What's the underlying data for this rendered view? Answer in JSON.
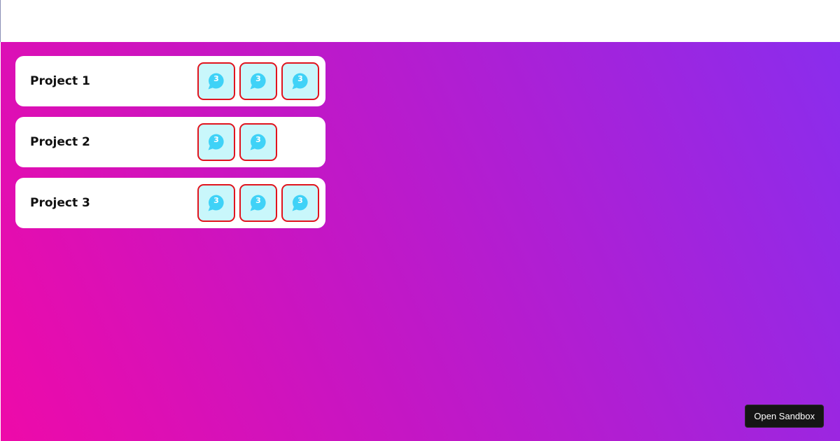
{
  "projects": [
    {
      "title": "Project 1",
      "badges": [
        {
          "count": "3"
        },
        {
          "count": "3"
        },
        {
          "count": "3"
        }
      ]
    },
    {
      "title": "Project 2",
      "badges": [
        {
          "count": "3"
        },
        {
          "count": "3"
        }
      ]
    },
    {
      "title": "Project 3",
      "badges": [
        {
          "count": "3"
        },
        {
          "count": "3"
        },
        {
          "count": "3"
        }
      ]
    }
  ],
  "badge_icon": "chat-bubble-icon",
  "sandbox_button": {
    "label": "Open Sandbox"
  },
  "colors": {
    "badge_border": "#e0141e",
    "badge_background": "#c9f7fb",
    "chat_icon": "#3fd2f7",
    "gradient_start": "#ee0aa9",
    "gradient_end": "#8a2ded"
  }
}
